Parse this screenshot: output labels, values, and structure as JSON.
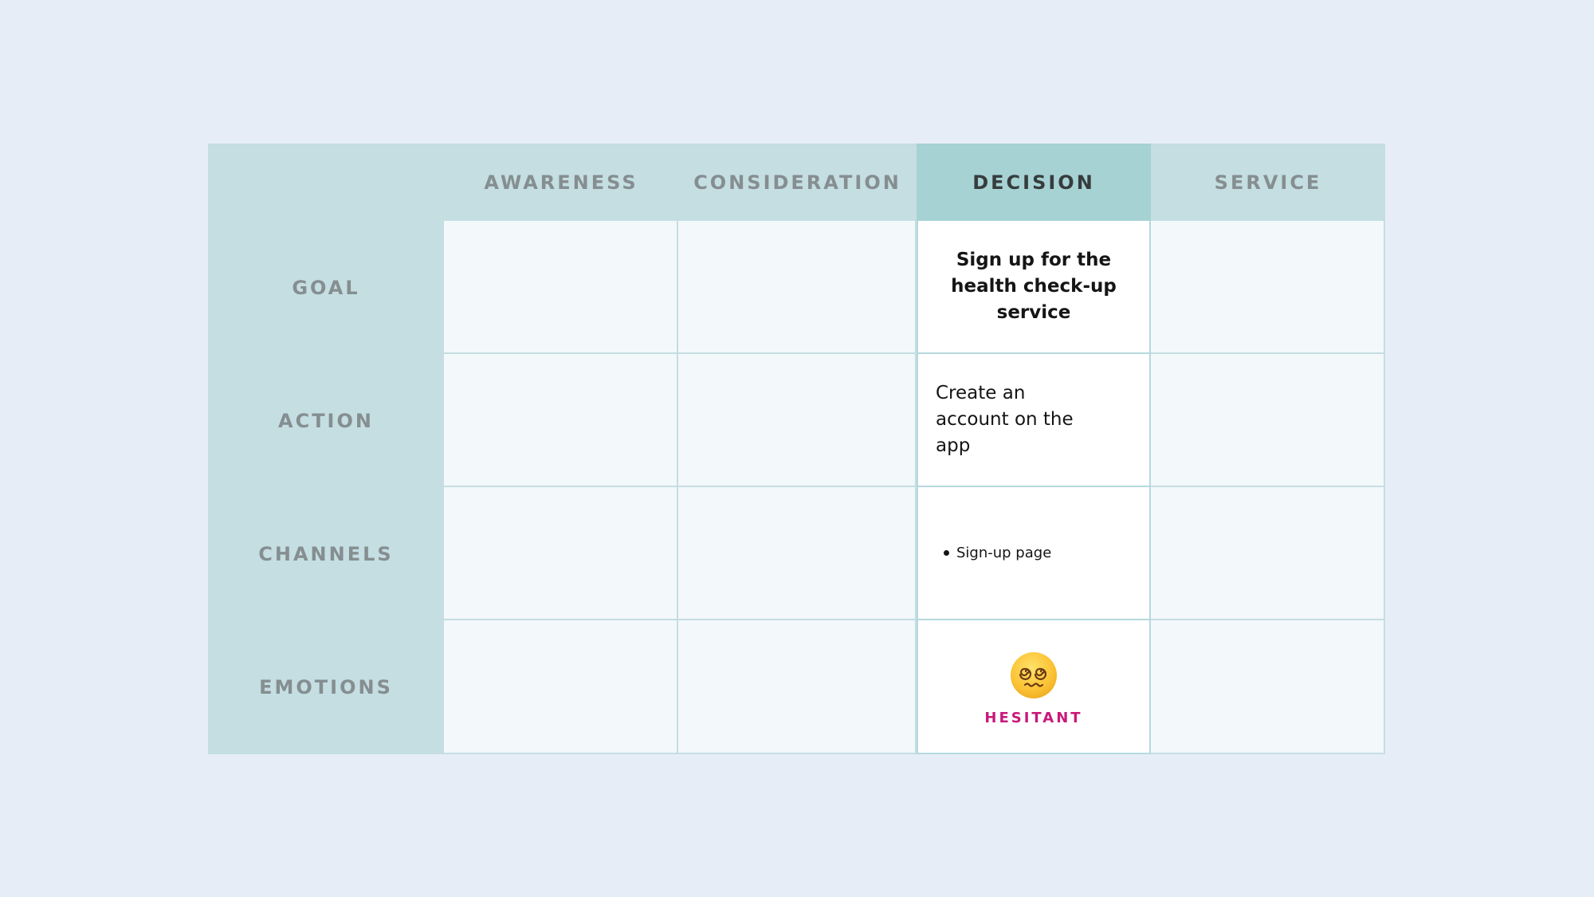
{
  "columns": [
    "AWARENESS",
    "CONSIDERATION",
    "DECISION",
    "SERVICE"
  ],
  "active_column": "DECISION",
  "rows": [
    "GOAL",
    "ACTION",
    "CHANNELS",
    "EMOTIONS"
  ],
  "decision": {
    "goal": "Sign up for the health check-up service",
    "action": "Create an account on the app",
    "channels": [
      "Sign-up page"
    ],
    "emotion": {
      "icon": "face-with-spiral-eyes-icon",
      "label": "HESITANT",
      "color": "#c9187a"
    }
  },
  "colors": {
    "background": "#e7edf6",
    "header": "#c4dee2",
    "active_header": "#a6d2d4",
    "cell": "#f3f8fb"
  }
}
